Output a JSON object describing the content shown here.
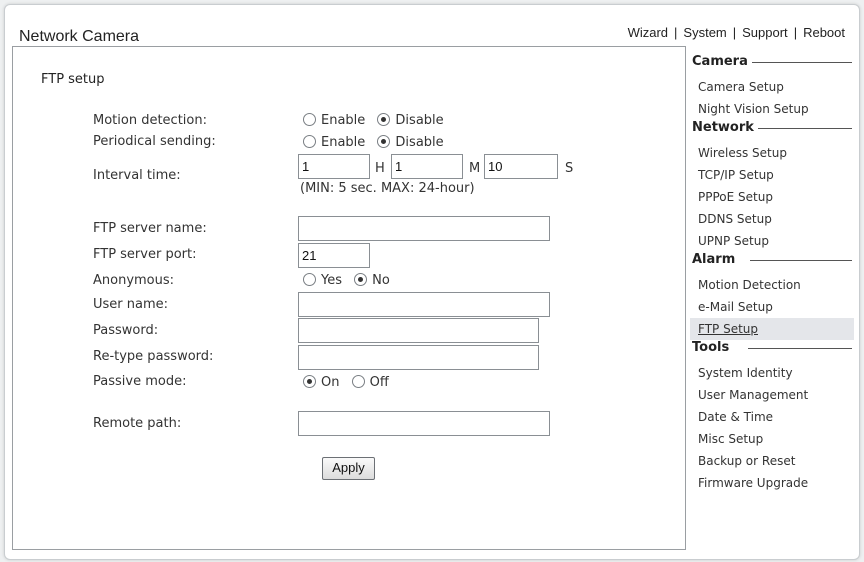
{
  "header": {
    "title": "Network Camera",
    "nav": [
      "Wizard",
      "System",
      "Support",
      "Reboot"
    ],
    "separator": "|"
  },
  "form": {
    "title": "FTP setup",
    "motion_detection": {
      "label": "Motion detection:",
      "options": [
        "Enable",
        "Disable"
      ],
      "selected": "Disable"
    },
    "periodical_sending": {
      "label": "Periodical sending:",
      "options": [
        "Enable",
        "Disable"
      ],
      "selected": "Disable"
    },
    "interval_time": {
      "label": "Interval time:",
      "hours": "1",
      "hours_unit": "H",
      "minutes": "1",
      "minutes_unit": "M",
      "seconds": "10",
      "seconds_unit": "S",
      "hint": "(MIN: 5 sec. MAX: 24-hour)"
    },
    "ftp_server_name": {
      "label": "FTP server name:",
      "value": ""
    },
    "ftp_server_port": {
      "label": "FTP server port:",
      "value": "21"
    },
    "anonymous": {
      "label": "Anonymous:",
      "options": [
        "Yes",
        "No"
      ],
      "selected": "No"
    },
    "user_name": {
      "label": "User name:",
      "value": ""
    },
    "password": {
      "label": "Password:",
      "value": ""
    },
    "retype_password": {
      "label": "Re-type password:",
      "value": ""
    },
    "passive_mode": {
      "label": "Passive mode:",
      "options": [
        "On",
        "Off"
      ],
      "selected": "On"
    },
    "remote_path": {
      "label": "Remote path:",
      "value": ""
    },
    "apply_label": "Apply"
  },
  "sidebar": {
    "sections": [
      {
        "title": "Camera",
        "items": [
          "Camera Setup",
          "Night Vision Setup"
        ]
      },
      {
        "title": "Network",
        "items": [
          "Wireless Setup",
          "TCP/IP Setup",
          "PPPoE Setup",
          "DDNS Setup",
          "UPNP Setup"
        ]
      },
      {
        "title": "Alarm",
        "items": [
          "Motion Detection",
          "e-Mail Setup",
          "FTP Setup"
        ]
      },
      {
        "title": "Tools",
        "items": [
          "System Identity",
          "User Management",
          "Date & Time",
          "Misc Setup",
          "Backup or Reset",
          "Firmware Upgrade"
        ]
      }
    ],
    "active_item": "FTP Setup"
  }
}
